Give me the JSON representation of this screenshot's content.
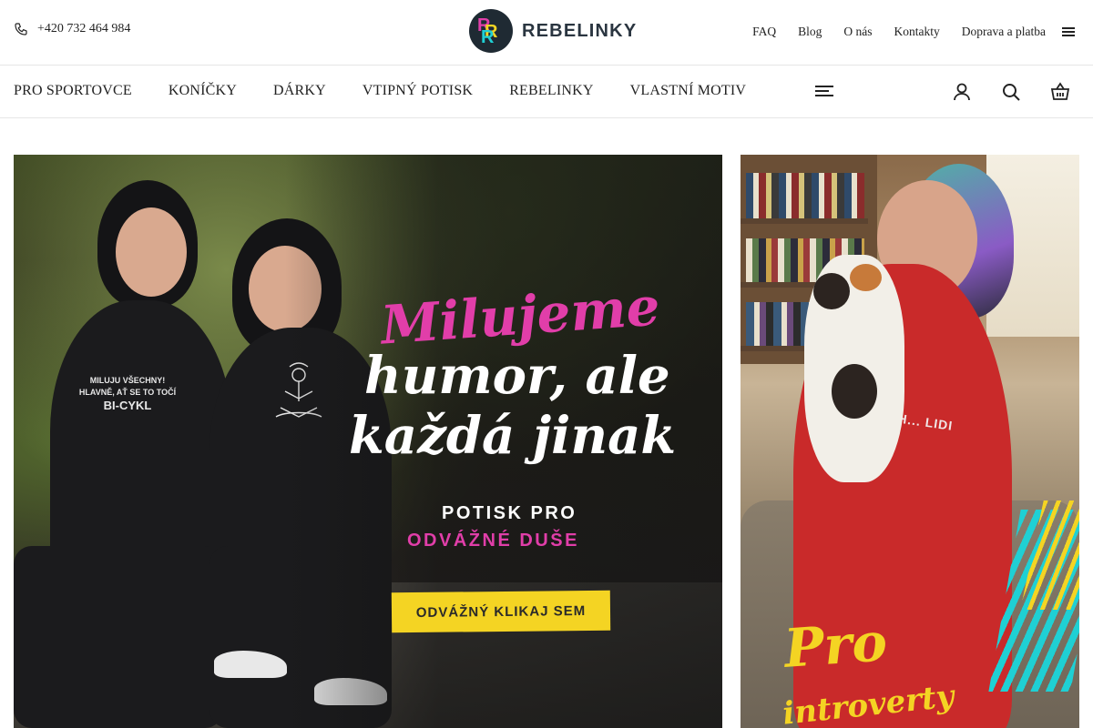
{
  "header": {
    "phone": "+420 732 464 984",
    "logo_text": "REBELINKY",
    "links": [
      "FAQ",
      "Blog",
      "O nás",
      "Kontakty",
      "Doprava a platba"
    ]
  },
  "nav": {
    "items": [
      "PRO SPORTOVCE",
      "KONÍČKY",
      "DÁRKY",
      "VTIPNÝ POTISK",
      "REBELINKY",
      "VLASTNÍ MOTIV"
    ]
  },
  "banner_main": {
    "headline_pink": "Milujeme",
    "headline_white_1": "humor, ale",
    "headline_white_2": "každá jinak",
    "sub_1": "POTISK PRO",
    "sub_2": "ODVÁŽNÉ DUŠE",
    "cta": "ODVÁŽNÝ KLIKAJ SEM",
    "shirt_left_line1": "MILUJU VŠECHNY!",
    "shirt_left_line2": "HLAVNĚ, AŤ SE TO TOČÍ",
    "shirt_left_line3": "BI-CYKL"
  },
  "banner_side": {
    "shirt_text": "EH... LIDI",
    "script_1": "Pro",
    "script_2": "introverty"
  },
  "colors": {
    "pink": "#e13ea9",
    "cta_yellow": "#f4d423",
    "accent_cyan": "#1fd0d4"
  }
}
